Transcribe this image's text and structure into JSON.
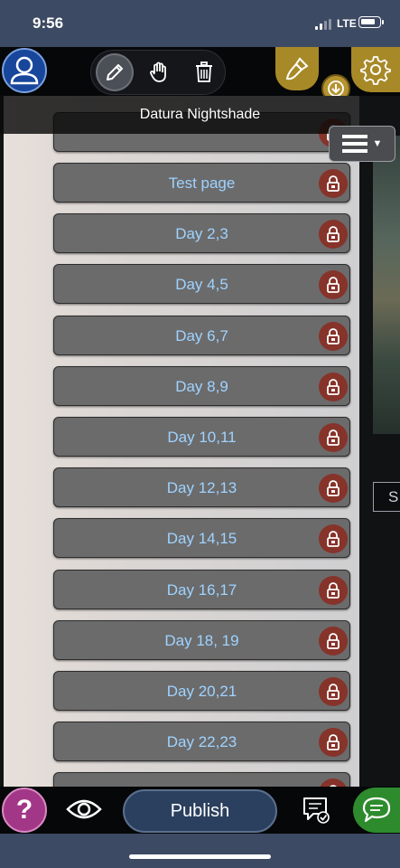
{
  "status_bar": {
    "time": "9:56",
    "network": "LTE"
  },
  "header": {
    "title": "Datura Nightshade"
  },
  "pages": [
    {
      "label": "Test page"
    },
    {
      "label": "Day 2,3"
    },
    {
      "label": "Day 4,5"
    },
    {
      "label": "Day 6,7"
    },
    {
      "label": "Day 8,9"
    },
    {
      "label": "Day 10,11"
    },
    {
      "label": "Day 12,13"
    },
    {
      "label": "Day 14,15"
    },
    {
      "label": "Day 16,17"
    },
    {
      "label": "Day 18, 19"
    },
    {
      "label": "Day 20,21"
    },
    {
      "label": "Day 22,23"
    }
  ],
  "right_box_text": "S",
  "bottom_bar": {
    "publish_label": "Publish",
    "help_label": "?"
  },
  "colors": {
    "accent_gold": "#a88928",
    "lock_red": "#86332a",
    "link_blue": "#9fd3ff",
    "chat_green": "#2d8b2d",
    "help_magenta": "#a33787"
  }
}
